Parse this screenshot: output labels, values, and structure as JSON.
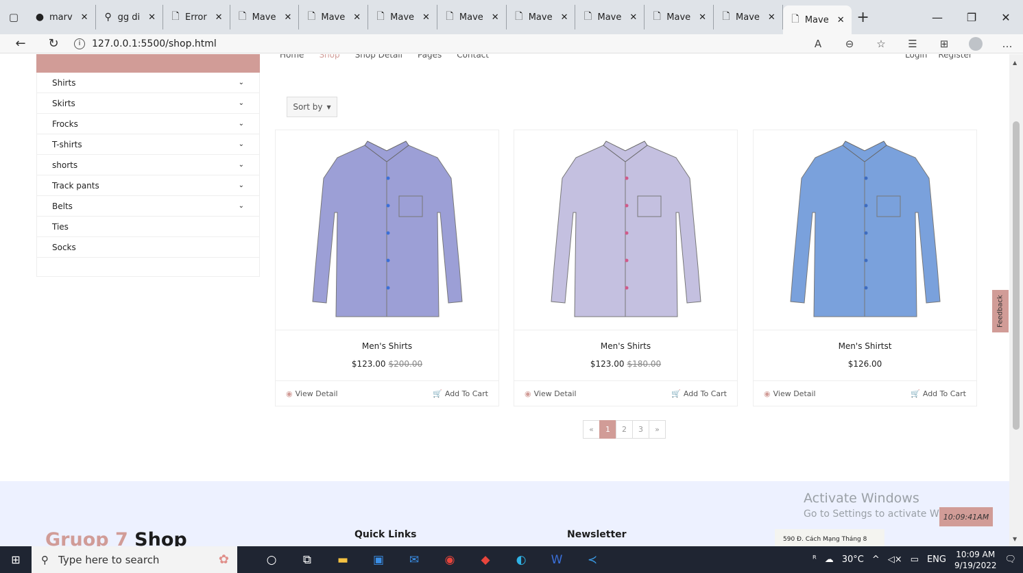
{
  "browser": {
    "tabs": [
      {
        "label": "marv",
        "icon": "github-icon",
        "active": false
      },
      {
        "label": "gg di",
        "icon": "search-icon",
        "active": false
      },
      {
        "label": "Error",
        "icon": "page-icon",
        "active": false
      },
      {
        "label": "Mave",
        "icon": "page-icon",
        "active": false
      },
      {
        "label": "Mave",
        "icon": "page-icon",
        "active": false
      },
      {
        "label": "Mave",
        "icon": "page-icon",
        "active": false
      },
      {
        "label": "Mave",
        "icon": "page-icon",
        "active": false
      },
      {
        "label": "Mave",
        "icon": "page-icon",
        "active": false
      },
      {
        "label": "Mave",
        "icon": "page-icon",
        "active": false
      },
      {
        "label": "Mave",
        "icon": "page-icon",
        "active": false
      },
      {
        "label": "Mave",
        "icon": "page-icon",
        "active": false
      },
      {
        "label": "Mave",
        "icon": "page-icon",
        "active": true
      }
    ],
    "url": "127.0.0.1:5500/shop.html"
  },
  "categories": [
    {
      "label": "Shirts",
      "expandable": true
    },
    {
      "label": "Skirts",
      "expandable": true
    },
    {
      "label": "Frocks",
      "expandable": true
    },
    {
      "label": "T-shirts",
      "expandable": true
    },
    {
      "label": "shorts",
      "expandable": true
    },
    {
      "label": "Track pants",
      "expandable": true
    },
    {
      "label": "Belts",
      "expandable": true
    },
    {
      "label": "Ties",
      "expandable": false
    },
    {
      "label": "Socks",
      "expandable": false
    }
  ],
  "toolbar": {
    "sort_label": "Sort by"
  },
  "products": [
    {
      "name": "Men's Shirts",
      "price": "$123.00",
      "old_price": "$200.00",
      "shirt_color": "#9c9fd6",
      "button_color": "#3b6fd8"
    },
    {
      "name": "Men's Shirts",
      "price": "$123.00",
      "old_price": "$180.00",
      "shirt_color": "#c4c0e0",
      "button_color": "#d05a8a"
    },
    {
      "name": "Men's Shirtst",
      "price": "$126.00",
      "old_price": "",
      "shirt_color": "#7aa1dc",
      "button_color": "#3e6cc0"
    }
  ],
  "card_actions": {
    "view": "View Detail",
    "cart": "Add To Cart"
  },
  "pagination": {
    "prev": "«",
    "pages": [
      "1",
      "2",
      "3"
    ],
    "next": "»",
    "active": "1"
  },
  "feedback": "Feedback",
  "footer": {
    "brand_part1": "Gruop 7",
    "brand_part2": "Shop",
    "quick_links": "Quick Links",
    "newsletter": "Newsletter",
    "activate_title": "Activate Windows",
    "activate_sub": "Go to Settings to activate W",
    "clock_badge": "10:09:41AM",
    "map_text": "590 Đ. Cách Mạng Tháng 8"
  },
  "taskbar": {
    "search_placeholder": "Type here to search",
    "weather": "30°C",
    "lang": "ENG",
    "time": "10:09 AM",
    "date": "9/19/2022"
  }
}
